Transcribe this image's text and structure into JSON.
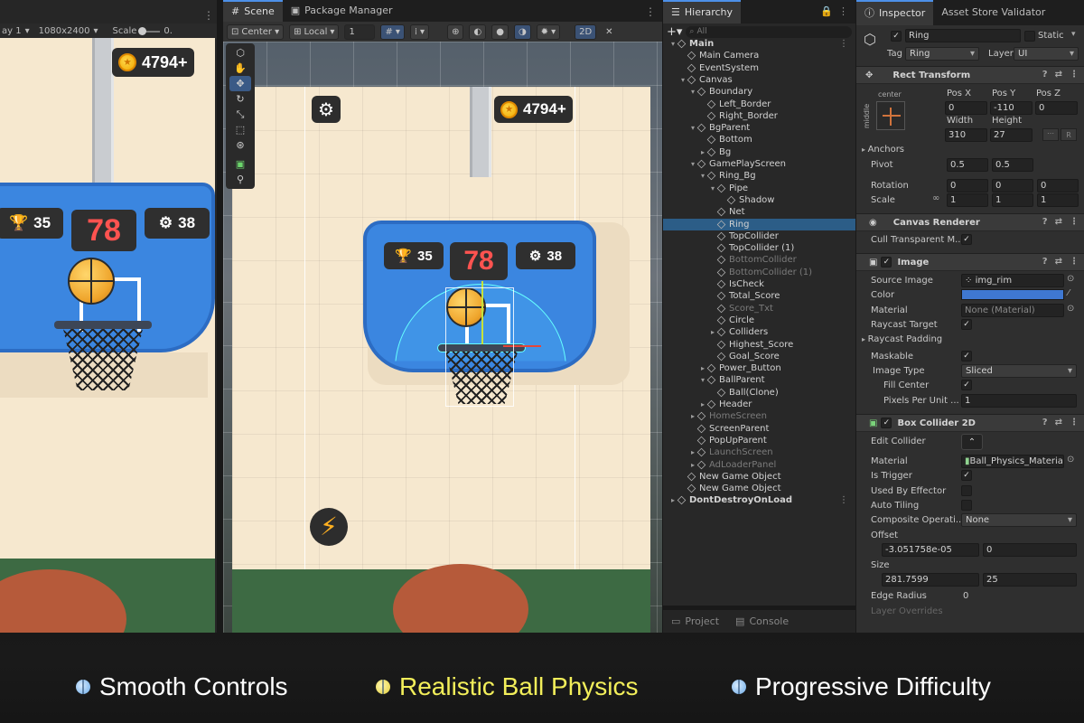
{
  "game_view": {
    "display_label": "ay 1",
    "resolution": "1080x2400",
    "scale_label": "Scale",
    "scale_value": "0.",
    "coins": "4794+",
    "best_score": "35",
    "current_score": "78",
    "hoops_count": "38"
  },
  "scene": {
    "tabs": [
      {
        "label": "Scene"
      },
      {
        "label": "Package Manager"
      }
    ],
    "toolbar": {
      "pivot": "Center",
      "space": "Local",
      "snap": "1",
      "mode_2d": "2D"
    },
    "coins": "4794+",
    "best_score": "35",
    "current_score": "78",
    "hoops_count": "38"
  },
  "hierarchy": {
    "title": "Hierarchy",
    "search_placeholder": "All",
    "items": [
      {
        "label": "Main",
        "depth": 0,
        "arrow": "▾",
        "dim": false,
        "sel": false,
        "dots": true
      },
      {
        "label": "Main Camera",
        "depth": 1,
        "arrow": "",
        "dim": false,
        "sel": false
      },
      {
        "label": "EventSystem",
        "depth": 1,
        "arrow": "",
        "dim": false,
        "sel": false
      },
      {
        "label": "Canvas",
        "depth": 1,
        "arrow": "▾",
        "dim": false,
        "sel": false
      },
      {
        "label": "Boundary",
        "depth": 2,
        "arrow": "▾",
        "dim": false,
        "sel": false
      },
      {
        "label": "Left_Border",
        "depth": 3,
        "arrow": "",
        "dim": false,
        "sel": false
      },
      {
        "label": "Right_Border",
        "depth": 3,
        "arrow": "",
        "dim": false,
        "sel": false
      },
      {
        "label": "BgParent",
        "depth": 2,
        "arrow": "▾",
        "dim": false,
        "sel": false
      },
      {
        "label": "Bottom",
        "depth": 3,
        "arrow": "",
        "dim": false,
        "sel": false
      },
      {
        "label": "Bg",
        "depth": 3,
        "arrow": "▸",
        "dim": false,
        "sel": false
      },
      {
        "label": "GamePlayScreen",
        "depth": 2,
        "arrow": "▾",
        "dim": false,
        "sel": false
      },
      {
        "label": "Ring_Bg",
        "depth": 3,
        "arrow": "▾",
        "dim": false,
        "sel": false
      },
      {
        "label": "Pipe",
        "depth": 4,
        "arrow": "▾",
        "dim": false,
        "sel": false
      },
      {
        "label": "Shadow",
        "depth": 5,
        "arrow": "",
        "dim": false,
        "sel": false
      },
      {
        "label": "Net",
        "depth": 4,
        "arrow": "",
        "dim": false,
        "sel": false
      },
      {
        "label": "Ring",
        "depth": 4,
        "arrow": "",
        "dim": false,
        "sel": true
      },
      {
        "label": "TopCollider",
        "depth": 4,
        "arrow": "",
        "dim": false,
        "sel": false
      },
      {
        "label": "TopCollider (1)",
        "depth": 4,
        "arrow": "",
        "dim": false,
        "sel": false
      },
      {
        "label": "BottomCollider",
        "depth": 4,
        "arrow": "",
        "dim": true,
        "sel": false
      },
      {
        "label": "BottomCollider (1)",
        "depth": 4,
        "arrow": "",
        "dim": true,
        "sel": false
      },
      {
        "label": "IsCheck",
        "depth": 4,
        "arrow": "",
        "dim": false,
        "sel": false
      },
      {
        "label": "Total_Score",
        "depth": 4,
        "arrow": "",
        "dim": false,
        "sel": false
      },
      {
        "label": "Score_Txt",
        "depth": 4,
        "arrow": "",
        "dim": true,
        "sel": false
      },
      {
        "label": "Circle",
        "depth": 4,
        "arrow": "",
        "dim": false,
        "sel": false
      },
      {
        "label": "Colliders",
        "depth": 4,
        "arrow": "▸",
        "dim": false,
        "sel": false
      },
      {
        "label": "Highest_Score",
        "depth": 4,
        "arrow": "",
        "dim": false,
        "sel": false
      },
      {
        "label": "Goal_Score",
        "depth": 4,
        "arrow": "",
        "dim": false,
        "sel": false
      },
      {
        "label": "Power_Button",
        "depth": 3,
        "arrow": "▸",
        "dim": false,
        "sel": false
      },
      {
        "label": "BallParent",
        "depth": 3,
        "arrow": "▾",
        "dim": false,
        "sel": false
      },
      {
        "label": "Ball(Clone)",
        "depth": 4,
        "arrow": "",
        "dim": false,
        "sel": false
      },
      {
        "label": "Header",
        "depth": 3,
        "arrow": "▸",
        "dim": false,
        "sel": false
      },
      {
        "label": "HomeScreen",
        "depth": 2,
        "arrow": "▸",
        "dim": true,
        "sel": false
      },
      {
        "label": "ScreenParent",
        "depth": 2,
        "arrow": "",
        "dim": false,
        "sel": false
      },
      {
        "label": "PopUpParent",
        "depth": 2,
        "arrow": "",
        "dim": false,
        "sel": false
      },
      {
        "label": "LaunchScreen",
        "depth": 2,
        "arrow": "▸",
        "dim": true,
        "sel": false
      },
      {
        "label": "AdLoaderPanel",
        "depth": 2,
        "arrow": "▸",
        "dim": true,
        "sel": false
      },
      {
        "label": "New Game Object",
        "depth": 1,
        "arrow": "",
        "dim": false,
        "sel": false
      },
      {
        "label": "New Game Object",
        "depth": 1,
        "arrow": "",
        "dim": false,
        "sel": false
      },
      {
        "label": "DontDestroyOnLoad",
        "depth": 0,
        "arrow": "▸",
        "dim": false,
        "sel": false,
        "dots": true
      }
    ]
  },
  "project_tabs": [
    {
      "label": "Project"
    },
    {
      "label": "Console"
    }
  ],
  "inspector": {
    "tabs": [
      {
        "label": "Inspector"
      },
      {
        "label": "Asset Store Validator"
      }
    ],
    "object_name": "Ring",
    "static_label": "Static",
    "tag_label": "Tag",
    "tag_value": "Ring",
    "layer_label": "Layer",
    "layer_value": "UI",
    "rect_transform": {
      "title": "Rect Transform",
      "anchor_h": "center",
      "anchor_v": "middle",
      "posx_label": "Pos X",
      "posy_label": "Pos Y",
      "posz_label": "Pos Z",
      "posx": "0",
      "posy": "-110",
      "posz": "0",
      "width_label": "Width",
      "height_label": "Height",
      "width": "310",
      "height": "27",
      "anchors_label": "Anchors",
      "pivot_label": "Pivot",
      "pivot_x": "0.5",
      "pivot_y": "0.5",
      "rotation_label": "Rotation",
      "rot_x": "0",
      "rot_y": "0",
      "rot_z": "0",
      "scale_label": "Scale",
      "scale_x": "1",
      "scale_y": "1",
      "scale_z": "1"
    },
    "canvas_renderer": {
      "title": "Canvas Renderer",
      "cull_label": "Cull Transparent M..."
    },
    "image": {
      "title": "Image",
      "source_label": "Source Image",
      "source_value": "img_rim",
      "color_label": "Color",
      "color_value": "#3f78d1",
      "material_label": "Material",
      "material_value": "None (Material)",
      "raycast_target_label": "Raycast Target",
      "raycast_padding_label": "Raycast Padding",
      "maskable_label": "Maskable",
      "image_type_label": "Image Type",
      "image_type_value": "Sliced",
      "fill_center_label": "Fill Center",
      "ppu_label": "Pixels Per Unit ...",
      "ppu_value": "1"
    },
    "box_collider": {
      "title": "Box Collider 2D",
      "edit_label": "Edit Collider",
      "material_label": "Material",
      "material_value": "Ball_Physics_Material",
      "is_trigger_label": "Is Trigger",
      "used_by_effector_label": "Used By Effector",
      "auto_tiling_label": "Auto Tiling",
      "composite_label": "Composite Operati...",
      "composite_value": "None",
      "offset_label": "Offset",
      "offset_x": "-3.051758e-05",
      "offset_y": "0",
      "size_label": "Size",
      "size_x": "281.7599",
      "size_y": "25",
      "edge_radius_label": "Edge Radius",
      "edge_radius_value": "0",
      "layer_overrides_label": "Layer Overrides"
    }
  },
  "banner": {
    "features": [
      {
        "label": "Smooth Controls",
        "color": "#ffffff"
      },
      {
        "label": "Realistic Ball Physics",
        "color": "#f2ee5a"
      },
      {
        "label": "Progressive Difficulty",
        "color": "#ffffff"
      }
    ]
  }
}
